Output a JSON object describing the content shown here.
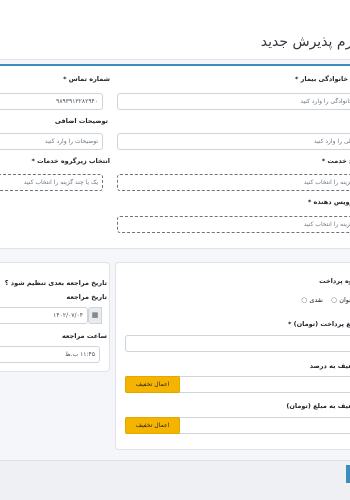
{
  "header": {
    "title": "فرم پذیرش جدید"
  },
  "form": {
    "family_name": {
      "label": "نام خانوادگی بیمار *",
      "placeholder": "نام خانوادگی را وارد کنید"
    },
    "phone": {
      "label": "شماره تماس *",
      "value": "۹۸۹۳۹۱۳۲۸۲۹۴۰"
    },
    "national_id": {
      "placeholder": "کد ملی را وارد کنید"
    },
    "notes": {
      "label": "توضیحات اضافی",
      "placeholder": "توضیحات را وارد کنید"
    },
    "service": {
      "label": "نوع خدمت *",
      "placeholder": "یک گزینه را انتخاب کنید"
    },
    "subgroup": {
      "label": "انتخاب زیرگروه خدمات *",
      "placeholder": "یک یا چند گزینه را انتخاب کنید"
    },
    "provider": {
      "label": "سرویس دهنده *",
      "placeholder": "یک گزینه را انتخاب کنید"
    }
  },
  "followup": {
    "question": "تاریخ مراجعه بعدی تنظیم شود ؟",
    "date_label": "تاریخ مراجعه",
    "date_value": "۱۴۰۲/۰۷/۰۴",
    "time_label": "ساعت مراجعه",
    "time_value": "۱۱:۴۵ ب.ظ"
  },
  "payment": {
    "method_label": "نحوه پرداخت",
    "option_cash": "نقدی",
    "option_other": "عنوان",
    "amount_label": "مبلغ پرداخت (تومان) *",
    "percent_discount_label": "تخفیف به درصد",
    "amount_discount_label": "تخفیف به مبلغ (تومان)",
    "apply_discount": "اعمال تخفیف"
  },
  "colors": {
    "accent": "#3c8dbc",
    "discount_button": "#f5b400"
  },
  "icons": {
    "calendar": "calendar-icon"
  }
}
